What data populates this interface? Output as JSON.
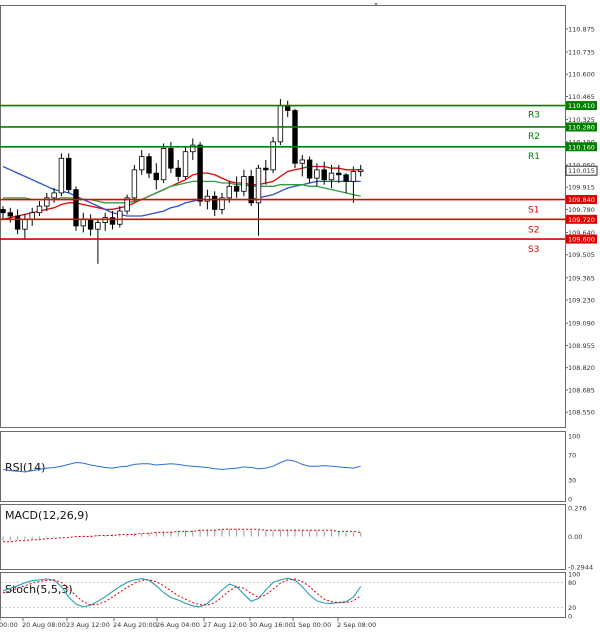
{
  "chart_data": {
    "type": "candlestick",
    "price_axis": {
      "ticks": [
        "110.875",
        "110.735",
        "110.600",
        "110.465",
        "110.325",
        "110.190",
        "110.050",
        "109.915",
        "109.780",
        "109.640",
        "109.505",
        "109.365",
        "109.230",
        "109.090",
        "108.955",
        "108.820",
        "108.685",
        "108.550"
      ],
      "range": [
        108.46,
        111.02
      ]
    },
    "x_ticks": [
      "00:00",
      "20 Aug 08:00",
      "23 Aug 12:00",
      "24 Aug 20:00",
      "26 Aug 04:00",
      "27 Aug 12:00",
      "30 Aug 16:00",
      "1 Sep 00:00",
      "2 Sep 08:00"
    ],
    "current_price": "110.015",
    "levels": [
      {
        "name": "R3",
        "price": 110.41,
        "label": "110.410",
        "color": "#008000"
      },
      {
        "name": "R2",
        "price": 110.28,
        "label": "110.280",
        "color": "#008000"
      },
      {
        "name": "R1",
        "price": 110.16,
        "label": "110.160",
        "color": "#008000"
      },
      {
        "name": "S1",
        "price": 109.84,
        "label": "109.840",
        "color": "#e00000"
      },
      {
        "name": "S2",
        "price": 109.72,
        "label": "109.720",
        "color": "#e00000"
      },
      {
        "name": "S3",
        "price": 109.6,
        "label": "109.600",
        "color": "#e00000"
      }
    ],
    "candles": [
      [
        109.78,
        109.8,
        109.72,
        109.76
      ],
      [
        109.76,
        109.79,
        109.7,
        109.74
      ],
      [
        109.74,
        109.78,
        109.63,
        109.66
      ],
      [
        109.66,
        109.75,
        109.6,
        109.72
      ],
      [
        109.72,
        109.79,
        109.68,
        109.76
      ],
      [
        109.76,
        109.83,
        109.74,
        109.8
      ],
      [
        109.8,
        109.88,
        109.77,
        109.85
      ],
      [
        109.85,
        109.91,
        109.82,
        109.88
      ],
      [
        109.88,
        110.12,
        109.86,
        110.09
      ],
      [
        110.09,
        110.12,
        109.88,
        109.9
      ],
      [
        109.9,
        109.92,
        109.65,
        109.68
      ],
      [
        109.68,
        109.76,
        109.64,
        109.72
      ],
      [
        109.72,
        109.75,
        109.62,
        109.66
      ],
      [
        109.66,
        109.72,
        109.45,
        109.7
      ],
      [
        109.7,
        109.76,
        109.65,
        109.73
      ],
      [
        109.73,
        109.77,
        109.66,
        109.69
      ],
      [
        109.69,
        109.8,
        109.67,
        109.77
      ],
      [
        109.77,
        109.87,
        109.75,
        109.85
      ],
      [
        109.85,
        110.05,
        109.83,
        110.02
      ],
      [
        110.02,
        110.14,
        109.99,
        110.1
      ],
      [
        110.1,
        110.12,
        109.97,
        110.0
      ],
      [
        110.0,
        110.06,
        109.9,
        109.96
      ],
      [
        109.96,
        110.18,
        109.94,
        110.15
      ],
      [
        110.15,
        110.19,
        110.0,
        110.03
      ],
      [
        110.03,
        110.08,
        109.95,
        109.98
      ],
      [
        109.98,
        110.16,
        109.96,
        110.13
      ],
      [
        110.13,
        110.21,
        110.08,
        110.17
      ],
      [
        110.17,
        110.19,
        109.8,
        109.83
      ],
      [
        109.83,
        109.9,
        109.78,
        109.86
      ],
      [
        109.86,
        109.89,
        109.74,
        109.78
      ],
      [
        109.78,
        109.88,
        109.75,
        109.85
      ],
      [
        109.85,
        109.95,
        109.82,
        109.92
      ],
      [
        109.92,
        109.98,
        109.85,
        109.89
      ],
      [
        109.89,
        110.02,
        109.86,
        109.98
      ],
      [
        109.98,
        110.02,
        109.8,
        109.82
      ],
      [
        109.82,
        110.05,
        109.62,
        110.03
      ],
      [
        110.03,
        110.08,
        109.93,
        110.02
      ],
      [
        110.02,
        110.22,
        110.0,
        110.19
      ],
      [
        110.19,
        110.45,
        110.17,
        110.41
      ],
      [
        110.41,
        110.44,
        110.34,
        110.38
      ],
      [
        110.38,
        110.39,
        110.03,
        110.06
      ],
      [
        110.06,
        110.11,
        109.98,
        110.08
      ],
      [
        110.08,
        110.1,
        109.94,
        109.97
      ],
      [
        109.97,
        110.06,
        109.92,
        110.02
      ],
      [
        110.02,
        110.07,
        109.93,
        109.96
      ],
      [
        109.96,
        110.05,
        109.91,
        110.0
      ],
      [
        110.0,
        110.05,
        109.94,
        109.99
      ],
      [
        109.99,
        110.0,
        109.88,
        109.95
      ],
      [
        109.95,
        110.04,
        109.82,
        110.01
      ],
      [
        110.01,
        110.05,
        109.98,
        110.02
      ]
    ],
    "moving_averages": [
      {
        "color": "#e00000",
        "values": [
          109.72,
          109.73,
          109.74,
          109.75,
          109.76,
          109.77,
          109.78,
          109.79,
          109.81,
          109.82,
          109.82,
          109.81,
          109.8,
          109.79,
          109.78,
          109.78,
          109.79,
          109.8,
          109.82,
          109.84,
          109.86,
          109.88,
          109.9,
          109.92,
          109.94,
          109.96,
          109.99,
          110.0,
          110.0,
          109.99,
          109.97,
          109.95,
          109.94,
          109.94,
          109.93,
          109.93,
          109.94,
          109.95,
          109.98,
          110.01,
          110.02,
          110.03,
          110.04,
          110.04,
          110.04,
          110.03,
          110.03,
          110.02,
          110.02,
          110.02
        ]
      },
      {
        "color": "#2b4fd6",
        "values": [
          110.04,
          110.02,
          110.0,
          109.98,
          109.96,
          109.94,
          109.92,
          109.9,
          109.89,
          109.88,
          109.86,
          109.84,
          109.82,
          109.8,
          109.78,
          109.76,
          109.75,
          109.74,
          109.74,
          109.74,
          109.75,
          109.76,
          109.77,
          109.79,
          109.8,
          109.82,
          109.83,
          109.84,
          109.84,
          109.84,
          109.84,
          109.84,
          109.84,
          109.84,
          109.84,
          109.85,
          109.86,
          109.87,
          109.89,
          109.91,
          109.92,
          109.93,
          109.94,
          109.95,
          109.95,
          109.95,
          109.95,
          109.95,
          109.95,
          109.95
        ]
      },
      {
        "color": "#2e9e44",
        "values": [
          109.85,
          109.85,
          109.85,
          109.85,
          109.84,
          109.84,
          109.84,
          109.84,
          109.85,
          109.85,
          109.85,
          109.84,
          109.84,
          109.83,
          109.82,
          109.82,
          109.82,
          109.82,
          109.83,
          109.84,
          109.86,
          109.88,
          109.9,
          109.92,
          109.93,
          109.94,
          109.95,
          109.95,
          109.95,
          109.95,
          109.94,
          109.94,
          109.93,
          109.93,
          109.92,
          109.92,
          109.92,
          109.92,
          109.93,
          109.93,
          109.93,
          109.93,
          109.92,
          109.92,
          109.91,
          109.9,
          109.89,
          109.88,
          109.87,
          109.86
        ]
      }
    ],
    "rsi": {
      "label": "RSI(14)",
      "ticks": [
        "100",
        "70",
        "30",
        "0"
      ],
      "values": [
        47,
        45,
        44,
        43,
        45,
        47,
        49,
        50,
        52,
        55,
        58,
        57,
        54,
        52,
        50,
        49,
        51,
        52,
        55,
        56,
        56,
        54,
        55,
        56,
        55,
        53,
        52,
        51,
        50,
        48,
        47,
        48,
        49,
        51,
        50,
        48,
        49,
        52,
        58,
        62,
        60,
        55,
        52,
        52,
        53,
        52,
        51,
        50,
        49,
        52
      ]
    },
    "macd": {
      "label": "MACD(12,26,9)",
      "ticks": [
        "0.276",
        "0.00",
        "-0.2944"
      ],
      "histogram": [
        -0.04,
        -0.04,
        -0.03,
        -0.03,
        -0.02,
        -0.02,
        -0.01,
        -0.01,
        0.0,
        0.0,
        0.0,
        0.01,
        0.01,
        0.01,
        0.01,
        0.02,
        0.02,
        0.02,
        0.03,
        0.03,
        0.04,
        0.04,
        0.05,
        0.05,
        0.05,
        0.06,
        0.06,
        0.07,
        0.07,
        0.07,
        0.07,
        0.07,
        0.07,
        0.06,
        0.06,
        0.06,
        0.06,
        0.06,
        0.07,
        0.07,
        0.07,
        0.06,
        0.06,
        0.06,
        0.05,
        0.05,
        0.05,
        0.04,
        0.04,
        0.04
      ],
      "signal": [
        -0.05,
        -0.05,
        -0.04,
        -0.04,
        -0.03,
        -0.03,
        -0.02,
        -0.02,
        -0.01,
        -0.01,
        0.0,
        0.0,
        0.0,
        0.01,
        0.01,
        0.01,
        0.02,
        0.02,
        0.02,
        0.03,
        0.03,
        0.04,
        0.04,
        0.04,
        0.05,
        0.05,
        0.05,
        0.06,
        0.06,
        0.06,
        0.07,
        0.07,
        0.07,
        0.07,
        0.07,
        0.07,
        0.06,
        0.06,
        0.06,
        0.06,
        0.06,
        0.06,
        0.06,
        0.06,
        0.06,
        0.06,
        0.05,
        0.05,
        0.05,
        0.04
      ]
    },
    "stoch": {
      "label": "Stoch(5,5,3)",
      "ticks": [
        "100",
        "80",
        "20",
        "0"
      ],
      "k": [
        60,
        66,
        72,
        79,
        84,
        86,
        88,
        85,
        70,
        45,
        28,
        22,
        26,
        35,
        46,
        58,
        70,
        80,
        86,
        89,
        85,
        72,
        56,
        44,
        38,
        30,
        24,
        22,
        30,
        46,
        62,
        76,
        70,
        52,
        35,
        42,
        62,
        80,
        86,
        90,
        85,
        70,
        50,
        36,
        31,
        30,
        32,
        34,
        45,
        70
      ],
      "d": [
        55,
        60,
        66,
        72,
        78,
        82,
        85,
        86,
        80,
        66,
        48,
        34,
        26,
        28,
        34,
        45,
        57,
        68,
        78,
        85,
        86,
        82,
        72,
        60,
        48,
        40,
        32,
        27,
        26,
        32,
        45,
        60,
        70,
        66,
        54,
        44,
        50,
        64,
        78,
        86,
        88,
        82,
        70,
        54,
        40,
        34,
        32,
        32,
        36,
        48
      ]
    }
  }
}
